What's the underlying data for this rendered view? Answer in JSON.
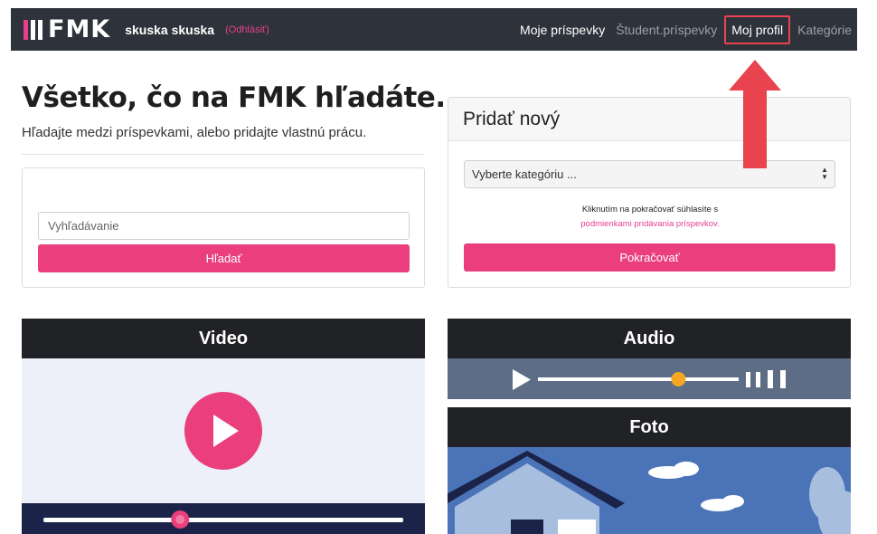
{
  "navbar": {
    "logo_text": "FMK",
    "user_name": "skuska skuska",
    "logout_label": "(Odhlásiť)",
    "links": [
      {
        "label": "Moje príspevky"
      },
      {
        "label": "Študent.príspevky"
      },
      {
        "label": "Moj profil"
      },
      {
        "label": "Kategórie"
      }
    ]
  },
  "hero": {
    "title": "Všetko, čo na FMK hľadáte.",
    "subtitle": "Hľadajte medzi príspevkami, alebo pridajte vlastnú prácu."
  },
  "search": {
    "placeholder": "Vyhľadávanie",
    "button_label": "Hľadať"
  },
  "add_new": {
    "title": "Pridať nový",
    "select_value": "Vyberte kategóriu ...",
    "terms_text": "Kliknutím na pokračovať súhlasíte s",
    "terms_link": "podmienkami pridávania príspevkov.",
    "continue_label": "Pokračovať"
  },
  "media": {
    "video_title": "Video",
    "audio_title": "Audio",
    "foto_title": "Foto",
    "video_progress": 0.38,
    "audio_progress": 0.7
  },
  "colors": {
    "accent": "#ea3f7c",
    "navbar_bg": "#2e333b",
    "annotation_red": "#e8434f"
  }
}
